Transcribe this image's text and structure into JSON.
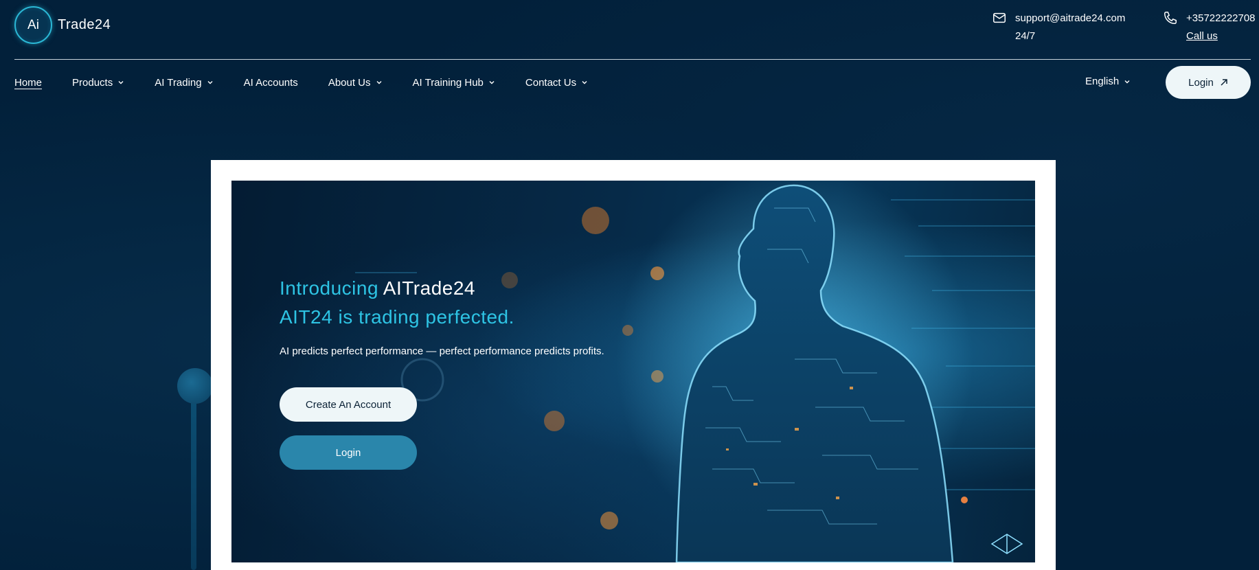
{
  "brand": {
    "logo_mark": "Ai",
    "name": "Trade24"
  },
  "contact": {
    "email": "support@aitrade24.com",
    "email_note": "24/7",
    "phone": "+35722222708",
    "phone_link": "Call us"
  },
  "nav": {
    "items": [
      {
        "label": "Home",
        "active": true,
        "dropdown": false
      },
      {
        "label": "Products",
        "active": false,
        "dropdown": true
      },
      {
        "label": "AI Trading",
        "active": false,
        "dropdown": true
      },
      {
        "label": "AI Accounts",
        "active": false,
        "dropdown": false
      },
      {
        "label": "About Us",
        "active": false,
        "dropdown": true
      },
      {
        "label": "AI Training Hub",
        "active": false,
        "dropdown": true
      },
      {
        "label": "Contact Us",
        "active": false,
        "dropdown": true
      }
    ],
    "language": "English",
    "login_label": "Login"
  },
  "hero": {
    "intro": "Introducing",
    "brand": "AITrade24",
    "tagline": "AIT24 is trading perfected.",
    "subtitle": "AI predicts perfect performance — perfect performance predicts profits.",
    "create_account_label": "Create An Account",
    "login_label": "Login"
  },
  "icons": {
    "email": "envelope-icon",
    "phone": "phone-icon",
    "dropdown": "chevron-down-icon",
    "external": "arrow-up-right-icon"
  },
  "colors": {
    "background": "#02203a",
    "accent_cyan": "#2ec4e4",
    "button_light": "#eef6f8",
    "button_blue": "#2a86ab"
  }
}
